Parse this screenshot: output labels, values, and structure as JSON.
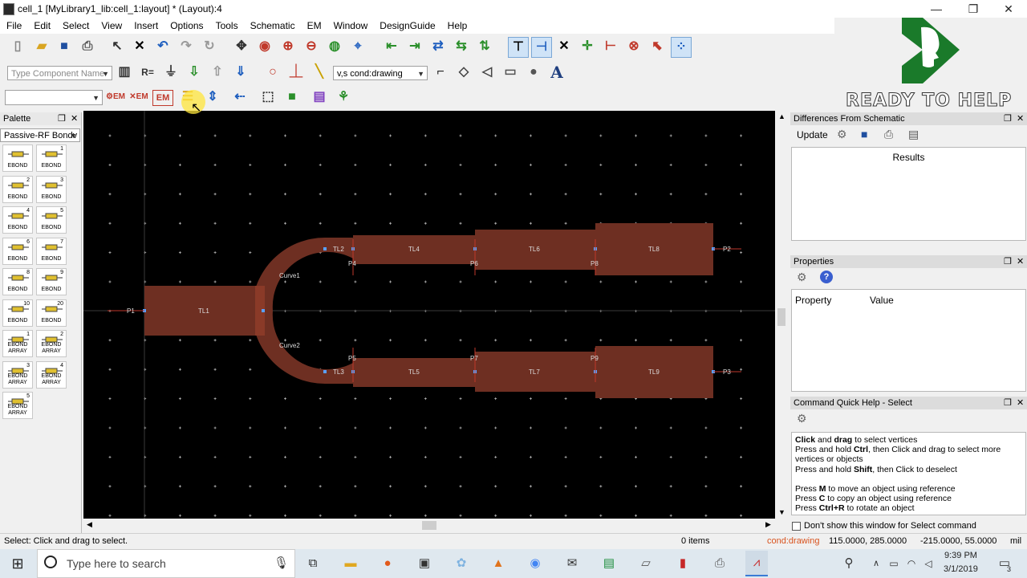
{
  "window": {
    "title": "cell_1 [MyLibrary1_lib:cell_1:layout] * (Layout):4",
    "minimize": "—",
    "maximize": "❐",
    "close": "✕"
  },
  "menu": [
    "File",
    "Edit",
    "Select",
    "View",
    "Insert",
    "Options",
    "Tools",
    "Schematic",
    "EM",
    "Window",
    "DesignGuide",
    "Help"
  ],
  "toolbar2": {
    "component_placeholder": "Type Component Name",
    "layer_value": "v,s cond:drawing",
    "text_tool": "A"
  },
  "toolbar3": {
    "em_label": "EM"
  },
  "brand": {
    "text": "READY TO HELP",
    "color": "#1a7a2a"
  },
  "palette": {
    "title": "Palette",
    "library": "Passive-RF Bondv",
    "items": [
      {
        "num": "",
        "label": "EBOND"
      },
      {
        "num": "1",
        "label": "EBOND"
      },
      {
        "num": "2",
        "label": "EBOND"
      },
      {
        "num": "3",
        "label": "EBOND"
      },
      {
        "num": "4",
        "label": "EBOND"
      },
      {
        "num": "5",
        "label": "EBOND"
      },
      {
        "num": "6",
        "label": "EBOND"
      },
      {
        "num": "7",
        "label": "EBOND"
      },
      {
        "num": "8",
        "label": "EBOND"
      },
      {
        "num": "9",
        "label": "EBOND"
      },
      {
        "num": "10",
        "label": "EBOND"
      },
      {
        "num": "20",
        "label": "EBOND"
      },
      {
        "num": "1",
        "label": "EBOND ARRAY"
      },
      {
        "num": "2",
        "label": "EBOND ARRAY"
      },
      {
        "num": "3",
        "label": "EBOND ARRAY"
      },
      {
        "num": "4",
        "label": "EBOND ARRAY"
      },
      {
        "num": "5",
        "label": "EBOND ARRAY"
      }
    ]
  },
  "layout": {
    "labels": {
      "tl1": "TL1",
      "tl2": "TL2",
      "tl3": "TL3",
      "tl4": "TL4",
      "tl5": "TL5",
      "tl6": "TL6",
      "tl7": "TL7",
      "tl8": "TL8",
      "tl9": "TL9",
      "curve1": "Curve1",
      "curve2": "Curve2",
      "p1": "P1",
      "p2": "P2",
      "p3": "P3",
      "p4": "P4",
      "p5": "P5",
      "p6": "P6",
      "p7": "P7",
      "p8": "P8",
      "p9": "P9"
    },
    "trace_color": "#6e2f22"
  },
  "diff_pane": {
    "title": "Differences From Schematic",
    "update": "Update",
    "results": "Results"
  },
  "props_pane": {
    "title": "Properties",
    "col_property": "Property",
    "col_value": "Value"
  },
  "help_pane": {
    "title": "Command Quick Help - Select",
    "lines": [
      {
        "b1": "Click",
        "t1": " and ",
        "b2": "drag",
        "t2": " to select vertices"
      },
      {
        "b1": "",
        "t1": "Press and hold ",
        "b2": "Ctrl",
        "t2": ", then Click and drag to select more vertices or objects"
      },
      {
        "b1": "",
        "t1": "Press and hold ",
        "b2": "Shift",
        "t2": ", then Click to deselect"
      },
      {
        "b1": "",
        "t1": "Press ",
        "b2": "M",
        "t2": " to move an object using reference"
      },
      {
        "b1": "",
        "t1": "Press ",
        "b2": "C",
        "t2": " to copy an object using reference"
      },
      {
        "b1": "",
        "t1": "Press ",
        "b2": "Ctrl+R",
        "t2": " to rotate an object"
      }
    ],
    "dont_show": "Don't show this window for Select command"
  },
  "status": {
    "left": "Select: Click and drag to select.",
    "items": "0 items",
    "layer": "cond:drawing",
    "coord1": "115.0000, 285.0000",
    "coord2": "-215.0000, 55.0000",
    "unit": "mil"
  },
  "taskbar": {
    "search_placeholder": "Type here to search",
    "time": "9:39 PM",
    "date": "3/1/2019",
    "notification_count": "3"
  }
}
